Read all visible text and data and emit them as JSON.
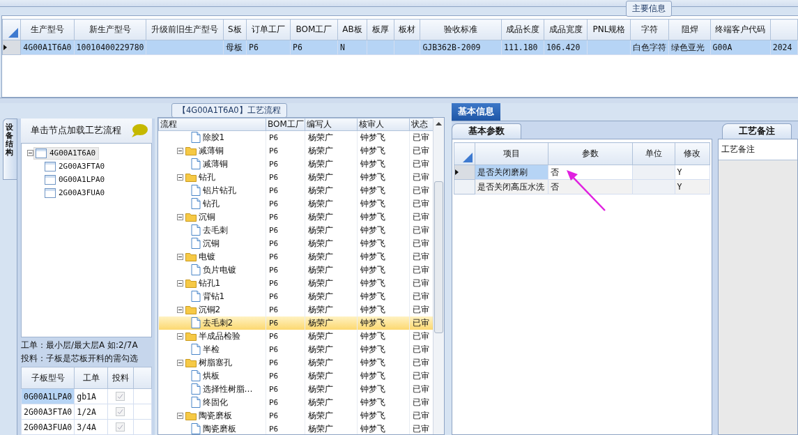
{
  "main_info": {
    "title": "主要信息",
    "columns": [
      "生产型号",
      "新生产型号",
      "升级前旧生产型号",
      "S板",
      "订单工厂",
      "BOM工厂",
      "AB板",
      "板厚",
      "板材",
      "验收标准",
      "成品长度",
      "成品宽度",
      "PNL规格",
      "字符",
      "阻焊",
      "终端客户代码",
      ""
    ],
    "rows": [
      {
        "selected": true,
        "cells": [
          "4G00A1T6A0",
          "10010400229780",
          "",
          "母板",
          "P6",
          "P6",
          "N",
          "",
          "",
          "GJB362B-2009",
          "111.180",
          "106.420",
          "",
          "白色字符",
          "绿色亚光",
          "G00A",
          "2024"
        ]
      }
    ]
  },
  "side_tab": {
    "label": "设备结构",
    "selected": true
  },
  "structure": {
    "header": "单击节点加载工艺流程",
    "tree": [
      {
        "label": "4G00A1T6A0",
        "selected": true,
        "expanded": true,
        "children": [
          {
            "label": "2G00A3FTA0",
            "selected": false
          },
          {
            "label": "0G00A1LPA0",
            "selected": false
          },
          {
            "label": "2G00A3FUA0",
            "selected": false
          }
        ]
      }
    ],
    "note_lines": [
      "工单：最小层/最大层A 如:2/7A",
      "投料：子板是芯板开料的需勾选"
    ],
    "sub_columns": [
      "子板型号",
      "工单",
      "投料"
    ],
    "sub_rows": [
      {
        "model": "0G00A1LPA0",
        "order": "gb1A",
        "feed": true,
        "selected": true
      },
      {
        "model": "2G00A3FTA0",
        "order": "1/2A",
        "feed": true,
        "selected": false
      },
      {
        "model": "2G00A3FUA0",
        "order": "3/4A",
        "feed": true,
        "selected": false
      }
    ]
  },
  "process": {
    "title": "【4G00A1T6A0】工艺流程",
    "columns": [
      "流程",
      "BOM工厂",
      "编写人",
      "核审人",
      "状态"
    ],
    "tree": [
      {
        "kind": "file",
        "label": "除胶1",
        "bom": "P6",
        "writer": "杨荣广",
        "reviewer": "钟梦飞",
        "status": "已审",
        "selected": false
      },
      {
        "kind": "folder",
        "label": "减薄铜",
        "bom": "P6",
        "writer": "杨荣广",
        "reviewer": "钟梦飞",
        "status": "已审",
        "selected": false,
        "children": [
          {
            "kind": "file",
            "label": "减薄铜",
            "bom": "P6",
            "writer": "杨荣广",
            "reviewer": "钟梦飞",
            "status": "已审",
            "selected": false
          }
        ]
      },
      {
        "kind": "folder",
        "label": "钻孔",
        "bom": "P6",
        "writer": "杨荣广",
        "reviewer": "钟梦飞",
        "status": "已审",
        "selected": false,
        "children": [
          {
            "kind": "file",
            "label": "铝片钻孔",
            "bom": "P6",
            "writer": "杨荣广",
            "reviewer": "钟梦飞",
            "status": "已审",
            "selected": false
          },
          {
            "kind": "file",
            "label": "钻孔",
            "bom": "P6",
            "writer": "杨荣广",
            "reviewer": "钟梦飞",
            "status": "已审",
            "selected": false
          }
        ]
      },
      {
        "kind": "folder",
        "label": "沉铜",
        "bom": "P6",
        "writer": "杨荣广",
        "reviewer": "钟梦飞",
        "status": "已审",
        "selected": false,
        "children": [
          {
            "kind": "file",
            "label": "去毛刺",
            "bom": "P6",
            "writer": "杨荣广",
            "reviewer": "钟梦飞",
            "status": "已审",
            "selected": false
          },
          {
            "kind": "file",
            "label": "沉铜",
            "bom": "P6",
            "writer": "杨荣广",
            "reviewer": "钟梦飞",
            "status": "已审",
            "selected": false
          }
        ]
      },
      {
        "kind": "folder",
        "label": "电镀",
        "bom": "P6",
        "writer": "杨荣广",
        "reviewer": "钟梦飞",
        "status": "已审",
        "selected": false,
        "children": [
          {
            "kind": "file",
            "label": "负片电镀",
            "bom": "P6",
            "writer": "杨荣广",
            "reviewer": "钟梦飞",
            "status": "已审",
            "selected": false
          }
        ]
      },
      {
        "kind": "folder",
        "label": "钻孔1",
        "bom": "P6",
        "writer": "杨荣广",
        "reviewer": "钟梦飞",
        "status": "已审",
        "selected": false,
        "children": [
          {
            "kind": "file",
            "label": "背钻1",
            "bom": "P6",
            "writer": "杨荣广",
            "reviewer": "钟梦飞",
            "status": "已审",
            "selected": false
          }
        ]
      },
      {
        "kind": "folder",
        "label": "沉铜2",
        "bom": "P6",
        "writer": "杨荣广",
        "reviewer": "钟梦飞",
        "status": "已审",
        "selected": false,
        "children": [
          {
            "kind": "file",
            "label": "去毛刺2",
            "bom": "P6",
            "writer": "杨荣广",
            "reviewer": "钟梦飞",
            "status": "已审",
            "selected": true
          }
        ]
      },
      {
        "kind": "folder",
        "label": "半成品检验",
        "bom": "P6",
        "writer": "杨荣广",
        "reviewer": "钟梦飞",
        "status": "已审",
        "selected": false,
        "children": [
          {
            "kind": "file",
            "label": "半检",
            "bom": "P6",
            "writer": "杨荣广",
            "reviewer": "钟梦飞",
            "status": "已审",
            "selected": false
          }
        ]
      },
      {
        "kind": "folder",
        "label": "树脂塞孔",
        "bom": "P6",
        "writer": "杨荣广",
        "reviewer": "钟梦飞",
        "status": "已审",
        "selected": false,
        "children": [
          {
            "kind": "file",
            "label": "烘板",
            "bom": "P6",
            "writer": "杨荣广",
            "reviewer": "钟梦飞",
            "status": "已审",
            "selected": false
          },
          {
            "kind": "file",
            "label": "选择性树脂…",
            "bom": "P6",
            "writer": "杨荣广",
            "reviewer": "钟梦飞",
            "status": "已审",
            "selected": false
          },
          {
            "kind": "file",
            "label": "终固化",
            "bom": "P6",
            "writer": "杨荣广",
            "reviewer": "钟梦飞",
            "status": "已审",
            "selected": false
          }
        ]
      },
      {
        "kind": "folder",
        "label": "陶瓷磨板",
        "bom": "P6",
        "writer": "杨荣广",
        "reviewer": "钟梦飞",
        "status": "已审",
        "selected": false,
        "children": [
          {
            "kind": "file",
            "label": "陶瓷磨板",
            "bom": "P6",
            "writer": "杨荣广",
            "reviewer": "钟梦飞",
            "status": "已审",
            "selected": false
          }
        ]
      }
    ]
  },
  "basic_info": {
    "tab": {
      "label": "基本信息",
      "selected": true
    },
    "params_tab": {
      "label": "基本参数",
      "selected": true
    },
    "columns": [
      "项目",
      "参数",
      "单位",
      "修改"
    ],
    "rows": [
      {
        "item": "是否关闭磨刷",
        "value": "否",
        "unit": "",
        "modify": "Y",
        "selected": true
      },
      {
        "item": "是否关闭高压水洗",
        "value": "否",
        "unit": "",
        "modify": "Y",
        "selected": false
      }
    ]
  },
  "notes": {
    "tab": {
      "label": "工艺备注",
      "selected": true
    },
    "header": "工艺备注"
  }
}
